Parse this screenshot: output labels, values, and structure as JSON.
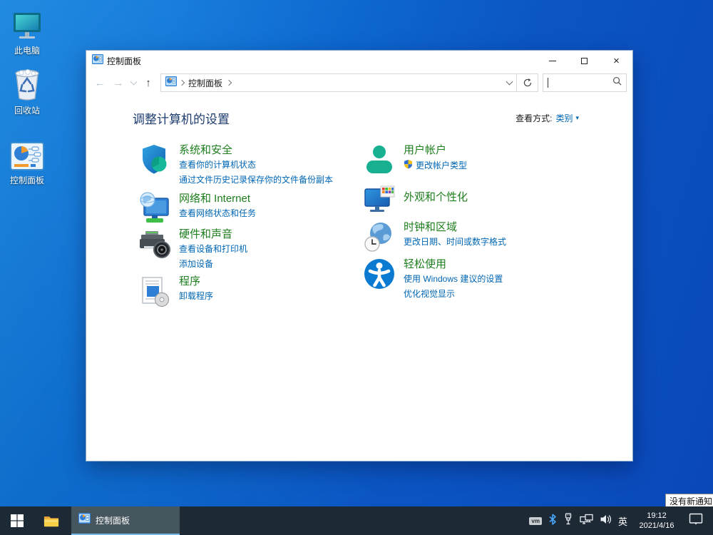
{
  "desktop": {
    "icons": [
      {
        "label": "此电脑"
      },
      {
        "label": "回收站"
      },
      {
        "label": "控制面板"
      }
    ]
  },
  "window": {
    "title": "控制面板",
    "nav": {
      "breadcrumb_item": "控制面板"
    },
    "content": {
      "heading": "调整计算机的设置",
      "view_by_label": "查看方式:",
      "view_by_value": "类别",
      "view_by_arrow": "▾",
      "left_categories": [
        {
          "title": "系统和安全",
          "links": [
            "查看你的计算机状态",
            "通过文件历史记录保存你的文件备份副本"
          ]
        },
        {
          "title": "网络和 Internet",
          "links": [
            "查看网络状态和任务"
          ]
        },
        {
          "title": "硬件和声音",
          "links": [
            "查看设备和打印机",
            "添加设备"
          ]
        },
        {
          "title": "程序",
          "links": [
            "卸载程序"
          ]
        }
      ],
      "right_categories": [
        {
          "title": "用户帐户",
          "links": [
            "更改帐户类型"
          ]
        },
        {
          "title": "外观和个性化",
          "links": []
        },
        {
          "title": "时钟和区域",
          "links": [
            "更改日期、时间或数字格式"
          ]
        },
        {
          "title": "轻松使用",
          "links": [
            "使用 Windows 建议的设置",
            "优化视觉显示"
          ]
        }
      ]
    }
  },
  "taskbar": {
    "task_label": "控制面板",
    "tray": {
      "vm_label": "vm",
      "input_indicator": "英",
      "time": "19:12",
      "date": "2021/4/16"
    },
    "tooltip": "没有新通知"
  },
  "colors": {
    "accent": "#0078d7",
    "category_title_green": "#1e7e1e",
    "link_blue": "#0066b4",
    "heading_navy": "#1d3c6e"
  }
}
